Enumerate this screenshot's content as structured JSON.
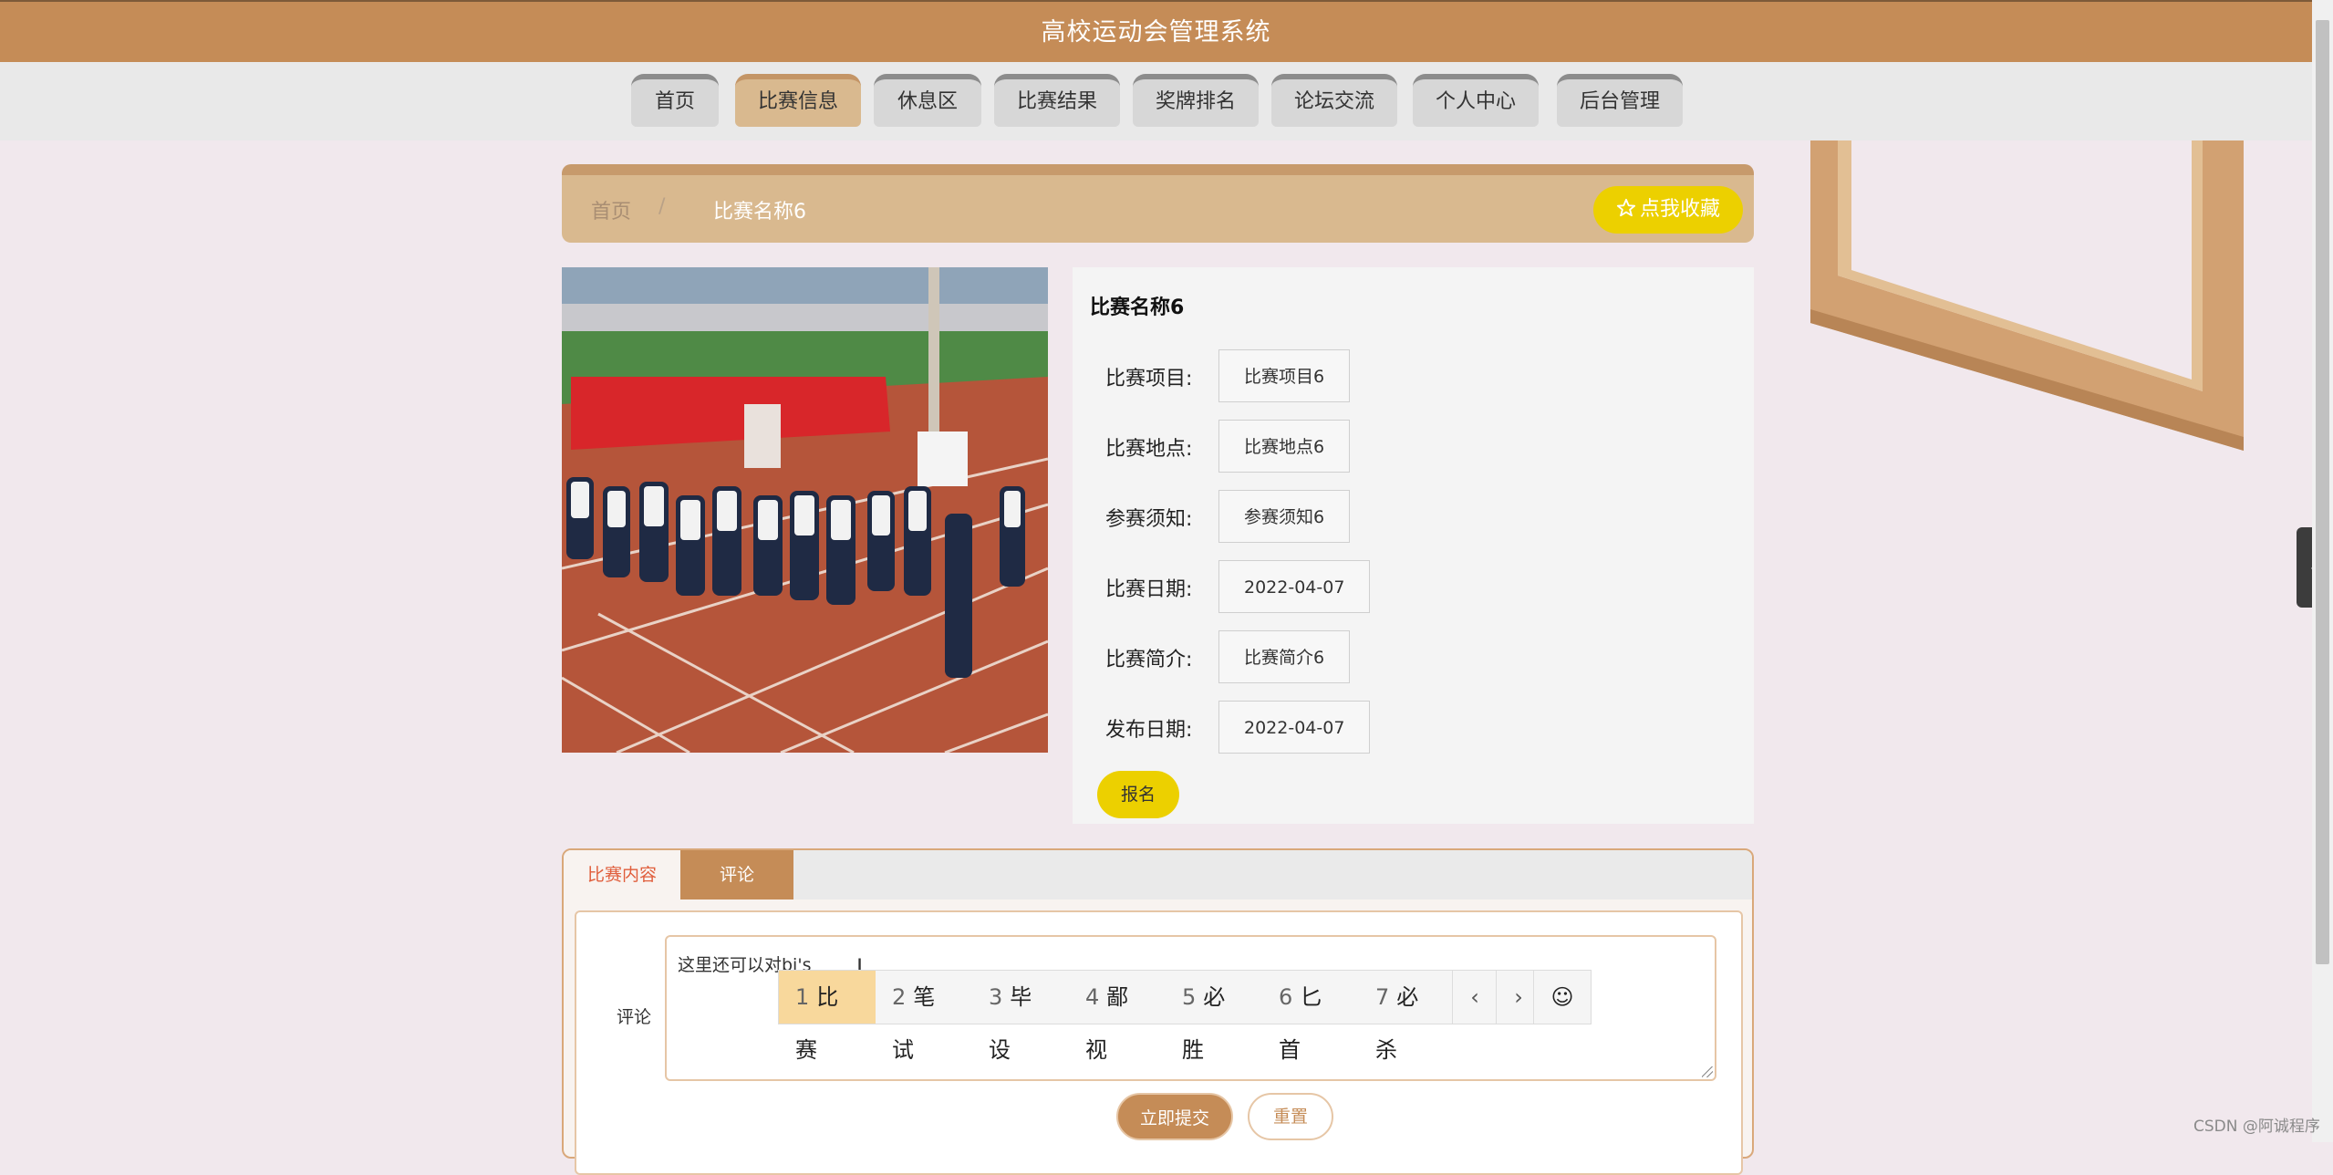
{
  "header": {
    "title": "高校运动会管理系统"
  },
  "nav": {
    "items": [
      {
        "label": "首页",
        "active": false
      },
      {
        "label": "比赛信息",
        "active": true
      },
      {
        "label": "休息区",
        "active": false
      },
      {
        "label": "比赛结果",
        "active": false
      },
      {
        "label": "奖牌排名",
        "active": false
      },
      {
        "label": "论坛交流",
        "active": false
      },
      {
        "label": "个人中心",
        "active": false
      },
      {
        "label": "后台管理",
        "active": false
      }
    ]
  },
  "breadcrumb": {
    "home": "首页",
    "separator": "/",
    "current": "比赛名称6",
    "favorite": "点我收藏",
    "favorite_icon": "star-outline-icon"
  },
  "detail": {
    "title": "比赛名称6",
    "fields": [
      {
        "label": "比赛项目:",
        "value": "比赛项目6"
      },
      {
        "label": "比赛地点:",
        "value": "比赛地点6"
      },
      {
        "label": "参赛须知:",
        "value": "参赛须知6"
      },
      {
        "label": "比赛日期:",
        "value": "2022-04-07"
      },
      {
        "label": "比赛简介:",
        "value": "比赛简介6"
      },
      {
        "label": "发布日期:",
        "value": "2022-04-07"
      }
    ],
    "signup": "报名"
  },
  "tabs": {
    "content": "比赛内容",
    "comments": "评论"
  },
  "comment_form": {
    "label": "评论",
    "text": "这里还可以对bi's",
    "submit": "立即提交",
    "reset": "重置"
  },
  "ime": {
    "candidates": [
      {
        "num": "1",
        "word": "比赛"
      },
      {
        "num": "2",
        "word": "笔试"
      },
      {
        "num": "3",
        "word": "毕设"
      },
      {
        "num": "4",
        "word": "鄙视"
      },
      {
        "num": "5",
        "word": "必胜"
      },
      {
        "num": "6",
        "word": "匕首"
      },
      {
        "num": "7",
        "word": "必杀"
      }
    ],
    "prev": "‹",
    "next": "›",
    "emoji": "☺"
  },
  "side_tab": {
    "icon": "‹"
  },
  "watermark": "CSDN @阿诚程序"
}
